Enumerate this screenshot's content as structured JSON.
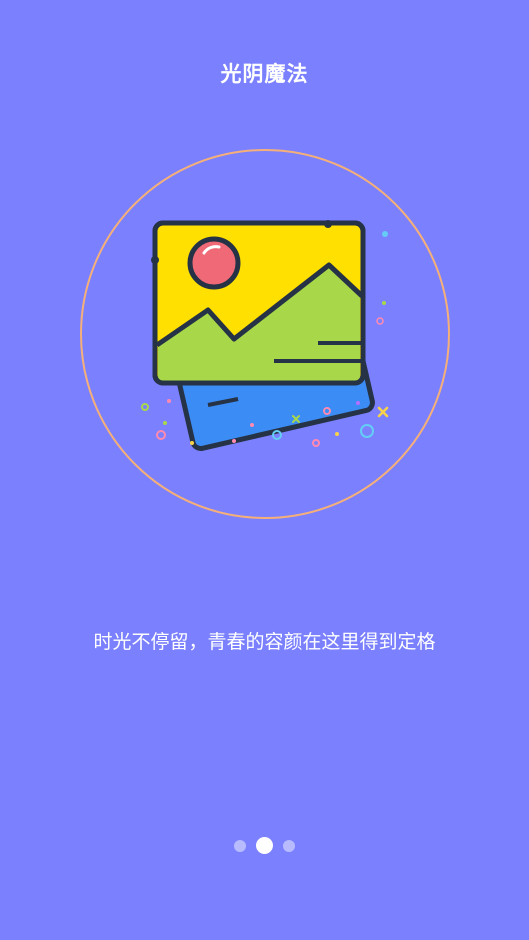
{
  "header": {
    "title": "光阴魔法"
  },
  "hero": {
    "illustration": "photo-gallery-icon",
    "ring_color": "#f5b07a",
    "photo_back_color": "#3b8cf4",
    "photo_front_color": "#ffe000",
    "hill_color": "#a8d84a",
    "sun_color": "#ef6a76"
  },
  "caption": {
    "text": "时光不停留，青春的容颜在这里得到定格"
  },
  "pager": {
    "total_pages": 3,
    "active_page": 2
  },
  "colors": {
    "background": "#7b80fe",
    "dot_inactive": "#b8bcff",
    "dot_active": "#ffffff"
  }
}
